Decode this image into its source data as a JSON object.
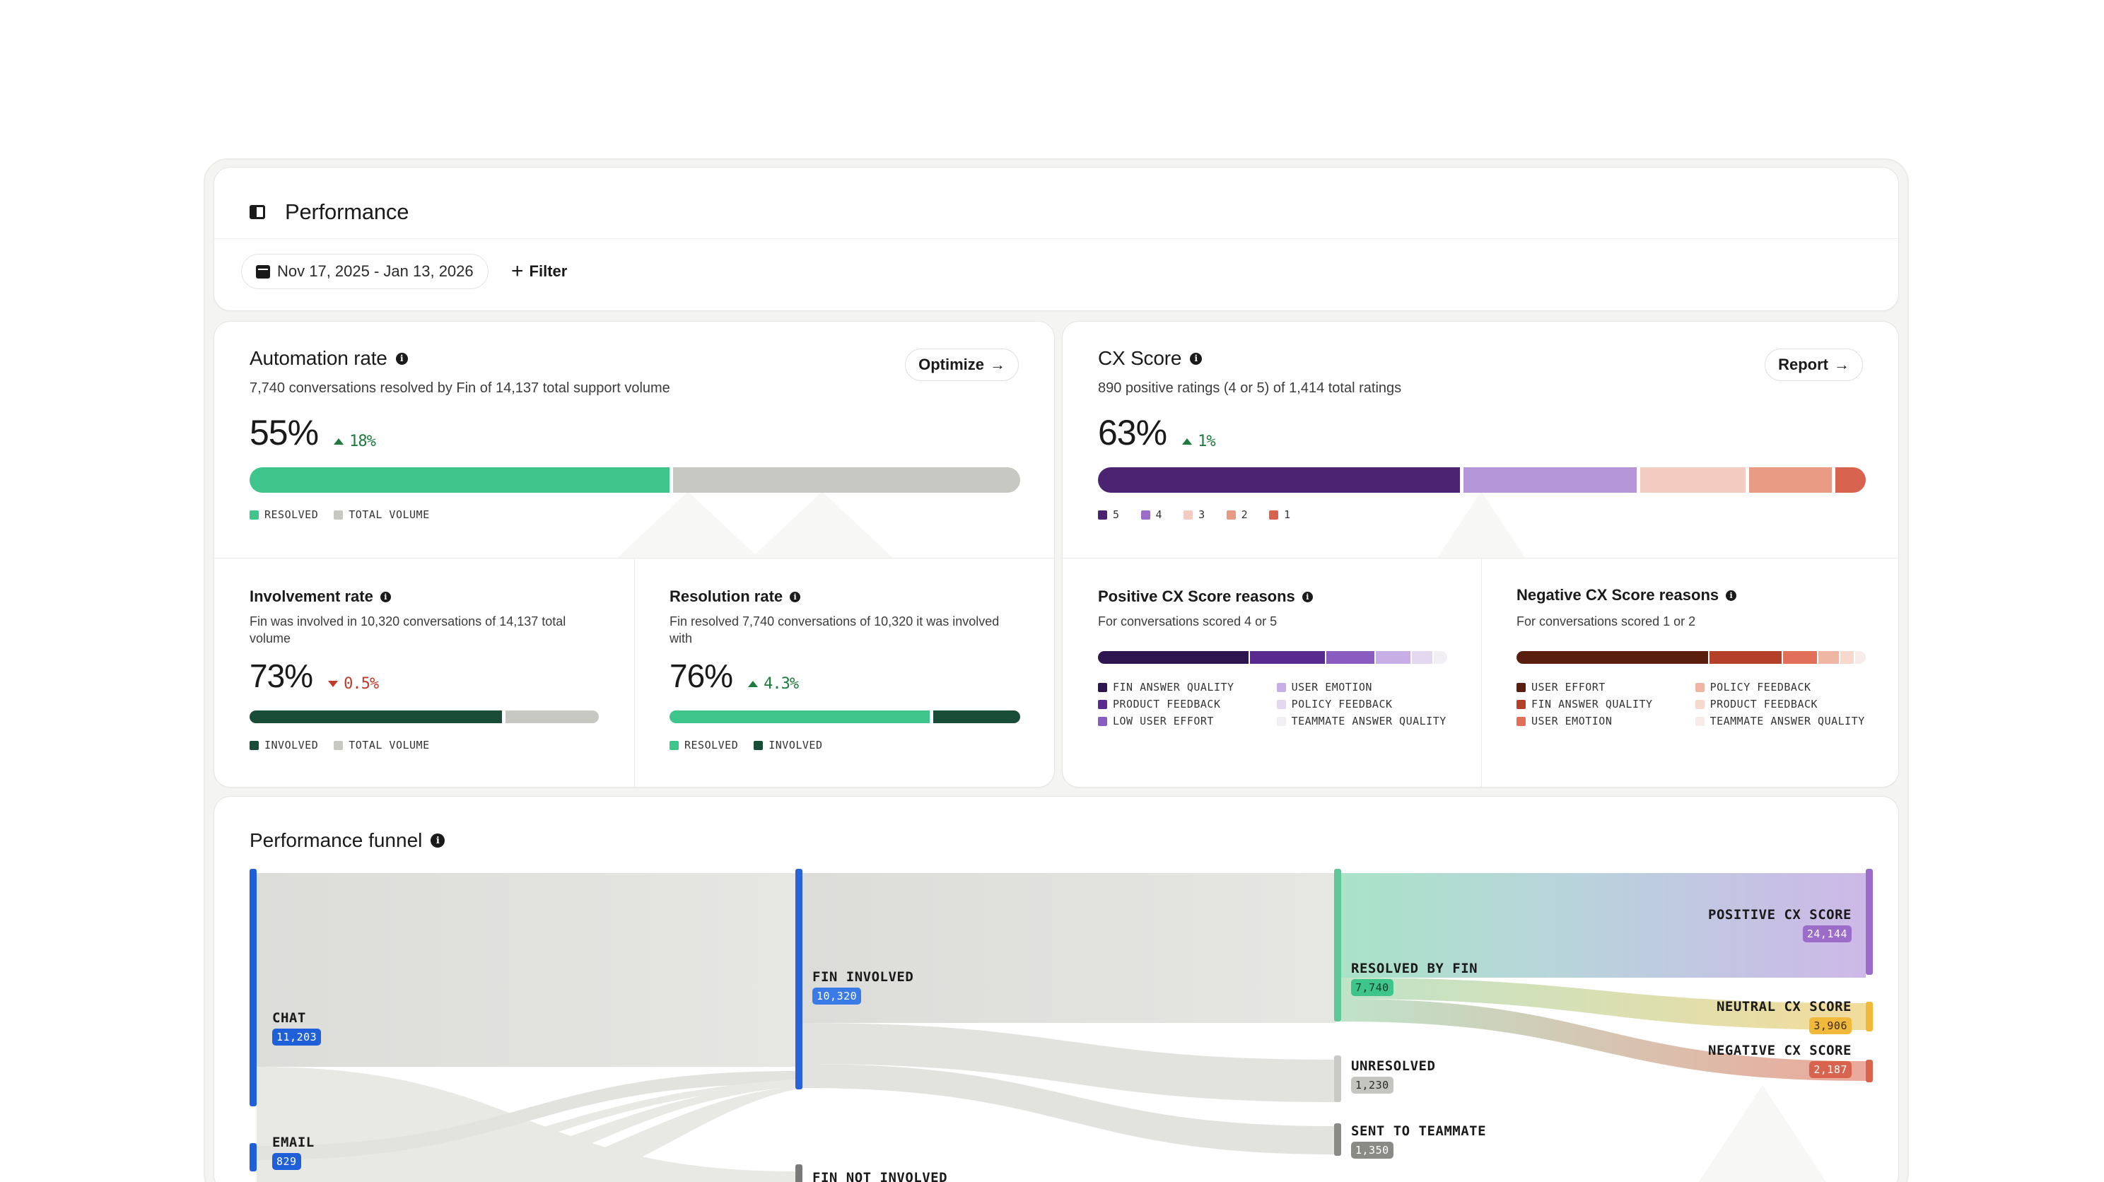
{
  "header": {
    "title": "Performance",
    "date_range": "Nov 17, 2025 - Jan 13, 2026",
    "filter_label": "Filter"
  },
  "automation": {
    "title": "Automation rate",
    "subtitle": "7,740 conversations resolved by Fin of 14,137 total support volume",
    "value": "55%",
    "delta": "18%",
    "delta_direction": "up",
    "action_label": "Optimize",
    "bar": [
      {
        "name": "RESOLVED",
        "fraction": 0.5475,
        "color": "#3ec58c"
      },
      {
        "name": "TOTAL VOLUME",
        "fraction": 0.4525,
        "color": "#c8c8c2"
      }
    ],
    "legend": [
      {
        "label": "RESOLVED",
        "color": "#3ec58c"
      },
      {
        "label": "TOTAL VOLUME",
        "color": "#c8c8c2"
      }
    ]
  },
  "involvement": {
    "title": "Involvement rate",
    "subtitle": "Fin was involved in 10,320 conversations of 14,137 total volume",
    "value": "73%",
    "delta": "0.5%",
    "delta_direction": "down",
    "bar": [
      {
        "name": "INVOLVED",
        "fraction": 0.73,
        "color": "#1a4d38"
      },
      {
        "name": "TOTAL VOLUME",
        "fraction": 0.27,
        "color": "#c8c8c2"
      }
    ],
    "legend": [
      {
        "label": "INVOLVED",
        "color": "#1a4d38"
      },
      {
        "label": "TOTAL VOLUME",
        "color": "#c8c8c2"
      }
    ]
  },
  "resolution": {
    "title": "Resolution rate",
    "subtitle": "Fin resolved 7,740 conversations of 10,320 it was involved with",
    "value": "76%",
    "delta": "4.3%",
    "delta_direction": "up",
    "bar": [
      {
        "name": "RESOLVED",
        "fraction": 0.75,
        "color": "#3ec58c"
      },
      {
        "name": "INVOLVED",
        "fraction": 0.25,
        "color": "#1a4d38"
      }
    ],
    "legend": [
      {
        "label": "RESOLVED",
        "color": "#3ec58c"
      },
      {
        "label": "INVOLVED",
        "color": "#1a4d38"
      }
    ]
  },
  "cx": {
    "title": "CX Score",
    "subtitle": "890 positive ratings (4 or 5) of 1,414 total ratings",
    "value": "63%",
    "delta": "1%",
    "delta_direction": "up",
    "action_label": "Report",
    "bar": [
      {
        "name": "5",
        "fraction": 0.48,
        "color": "#4b2370"
      },
      {
        "name": "4",
        "fraction": 0.23,
        "color": "#b596d8"
      },
      {
        "name": "3",
        "fraction": 0.14,
        "color": "#f4cbc0"
      },
      {
        "name": "2",
        "fraction": 0.11,
        "color": "#e89a82"
      },
      {
        "name": "1",
        "fraction": 0.04,
        "color": "#d86450"
      }
    ],
    "legend": [
      {
        "label": "5",
        "color": "#4b2370"
      },
      {
        "label": "4",
        "color": "#9b6cc8"
      },
      {
        "label": "3",
        "color": "#f4cbc0"
      },
      {
        "label": "2",
        "color": "#e89a82"
      },
      {
        "label": "1",
        "color": "#d86450"
      }
    ]
  },
  "positive_reasons": {
    "title": "Positive CX Score reasons",
    "subtitle": "For conversations scored 4 or 5",
    "bar": [
      {
        "fraction": 0.44,
        "color": "#2d1650"
      },
      {
        "fraction": 0.22,
        "color": "#5a2b8e"
      },
      {
        "fraction": 0.14,
        "color": "#8b5cc0"
      },
      {
        "fraction": 0.1,
        "color": "#c7aee4"
      },
      {
        "fraction": 0.06,
        "color": "#e3d8ef"
      },
      {
        "fraction": 0.04,
        "color": "#f1eef4"
      }
    ],
    "legend": [
      {
        "label": "FIN ANSWER QUALITY",
        "color": "#2d1650"
      },
      {
        "label": "USER EMOTION",
        "color": "#c7aee4"
      },
      {
        "label": "PRODUCT FEEDBACK",
        "color": "#5a2b8e"
      },
      {
        "label": "POLICY FEEDBACK",
        "color": "#e3d8ef"
      },
      {
        "label": "LOW USER EFFORT",
        "color": "#8b5cc0"
      },
      {
        "label": "TEAMMATE ANSWER QUALITY",
        "color": "#f1eef4"
      }
    ]
  },
  "negative_reasons": {
    "title": "Negative CX Score reasons",
    "subtitle": "For conversations scored 1 or 2",
    "bar": [
      {
        "fraction": 0.56,
        "color": "#5a1e0e"
      },
      {
        "fraction": 0.21,
        "color": "#b5402a"
      },
      {
        "fraction": 0.1,
        "color": "#e0705a"
      },
      {
        "fraction": 0.06,
        "color": "#f0b6a4"
      },
      {
        "fraction": 0.04,
        "color": "#f6d8cc"
      },
      {
        "fraction": 0.03,
        "color": "#f8ecea"
      }
    ],
    "legend": [
      {
        "label": "USER EFFORT",
        "color": "#5a1e0e"
      },
      {
        "label": "POLICY FEEDBACK",
        "color": "#f0b6a4"
      },
      {
        "label": "FIN ANSWER QUALITY",
        "color": "#b5402a"
      },
      {
        "label": "PRODUCT FEEDBACK",
        "color": "#f6d8cc"
      },
      {
        "label": "USER EMOTION",
        "color": "#e0705a"
      },
      {
        "label": "TEAMMATE ANSWER QUALITY",
        "color": "#f8ecea"
      }
    ]
  },
  "funnel": {
    "title": "Performance funnel",
    "nodes": {
      "chat": {
        "label": "CHAT",
        "value": "11,203",
        "color": "#1f5fd8"
      },
      "email": {
        "label": "EMAIL",
        "value": "829",
        "color": "#1f5fd8"
      },
      "fin_involved": {
        "label": "FIN INVOLVED",
        "value": "10,320",
        "color": "#3a7be8"
      },
      "fin_not_involved": {
        "label": "FIN NOT INVOLVED",
        "color": "#7a7a7a"
      },
      "resolved": {
        "label": "RESOLVED BY FIN",
        "value": "7,740",
        "color": "#3ec58c"
      },
      "unresolved": {
        "label": "UNRESOLVED",
        "value": "1,230",
        "color": "#b8b8b4"
      },
      "sent_to_teammate": {
        "label": "SENT TO TEAMMATE",
        "value": "1,350",
        "color": "#8a8a86"
      },
      "positive": {
        "label": "POSITIVE CX SCORE",
        "value": "24,144",
        "color": "#9b6cc8"
      },
      "neutral": {
        "label": "NEUTRAL CX SCORE",
        "value": "3,906",
        "color": "#f1b93c"
      },
      "negative": {
        "label": "NEGATIVE CX SCORE",
        "value": "2,187",
        "color": "#d86450"
      }
    }
  }
}
